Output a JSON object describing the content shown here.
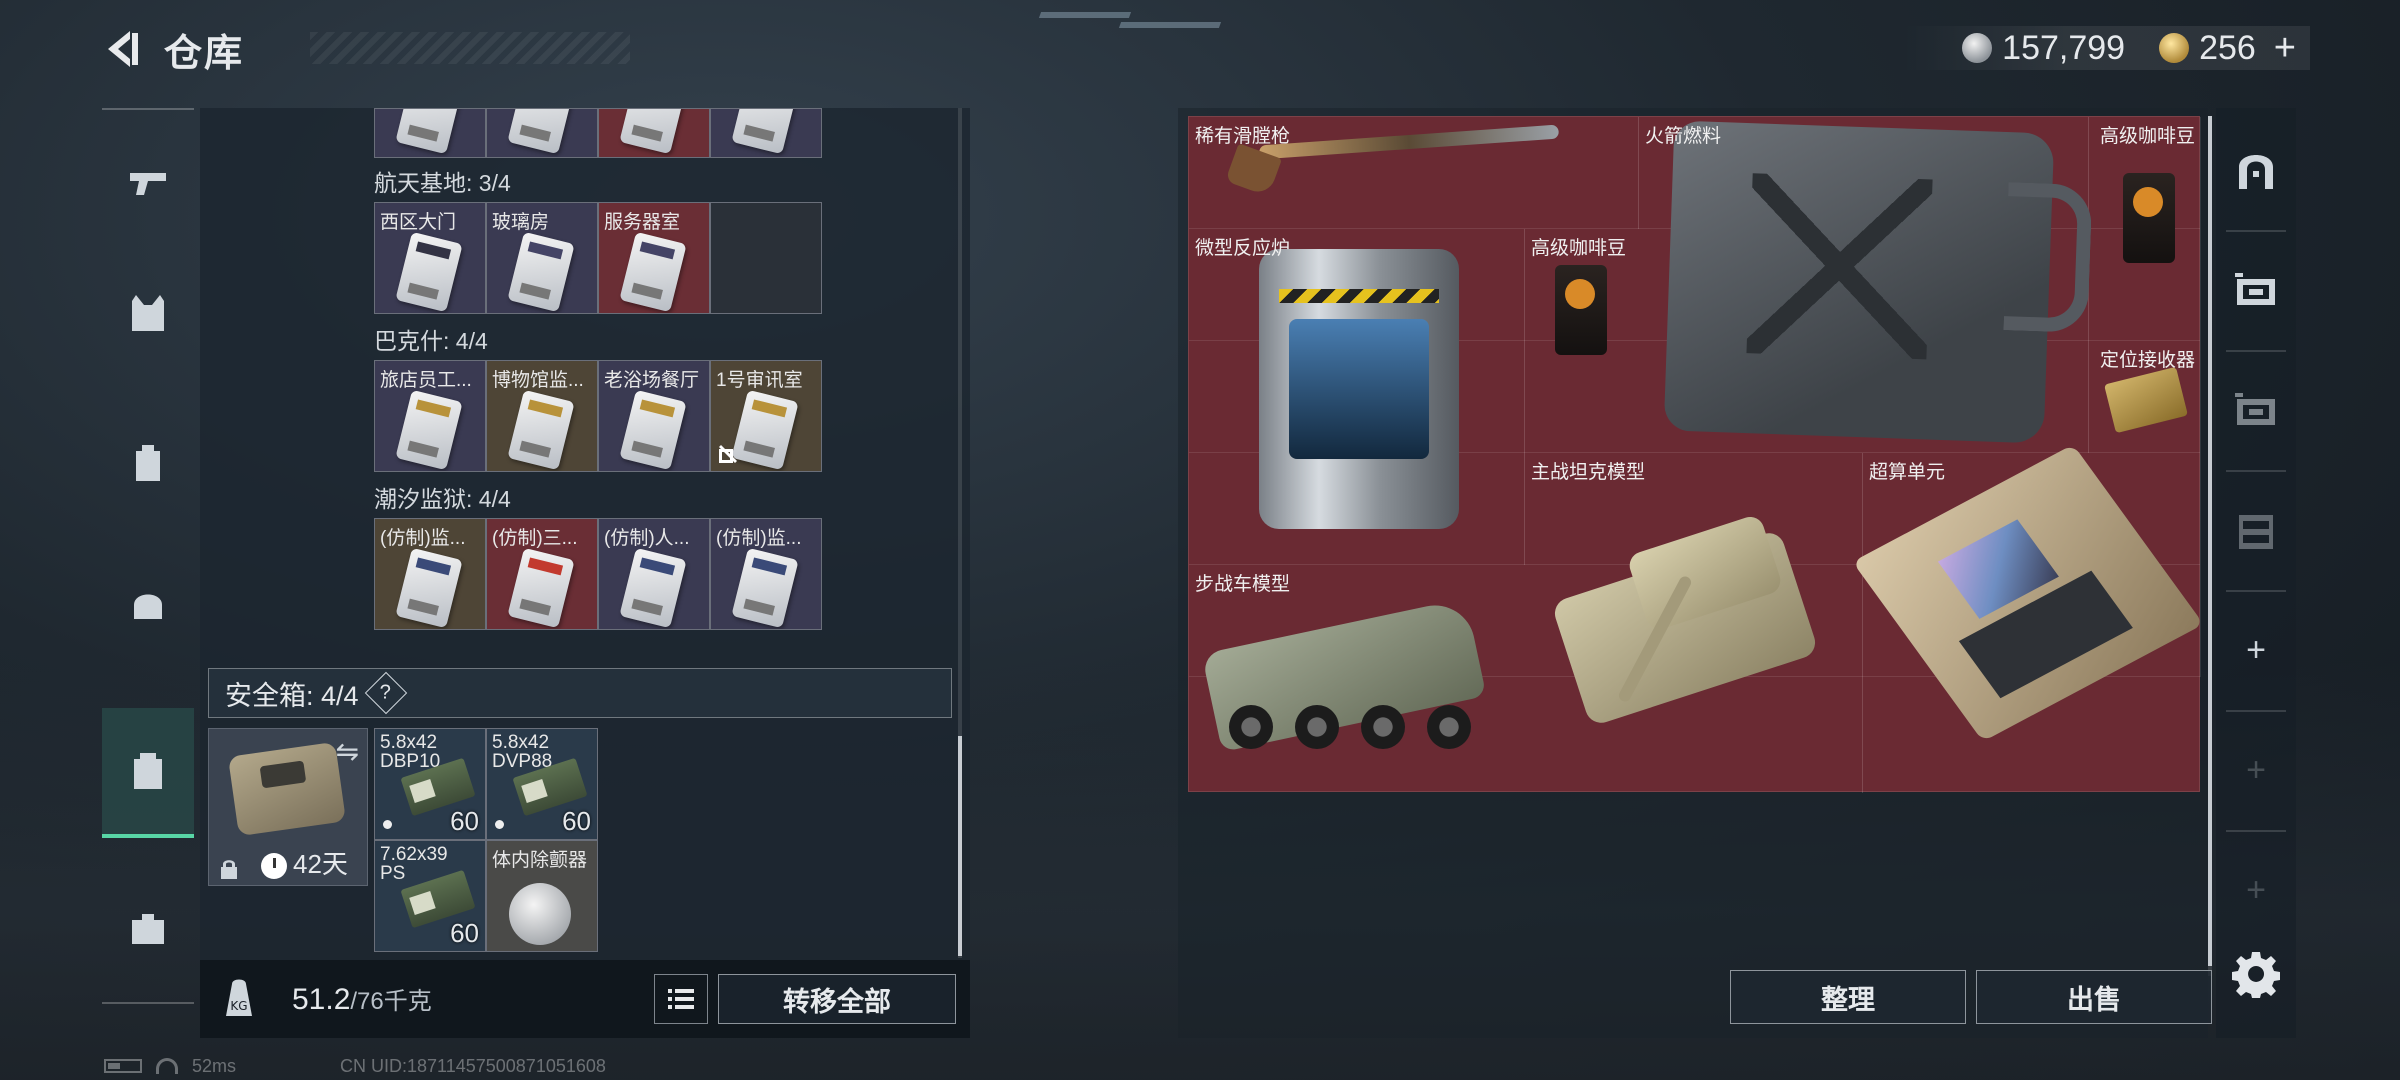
{
  "header": {
    "title": "仓库"
  },
  "currency": {
    "silver": "157,799",
    "gold": "256",
    "plus": "+"
  },
  "left_rail": {
    "items": [
      {
        "name": "weapons",
        "icon": "gun-icon"
      },
      {
        "name": "armor",
        "icon": "vest-icon"
      },
      {
        "name": "backpacks",
        "icon": "backpack-icon"
      },
      {
        "name": "chest-rig",
        "icon": "helmet-bag-icon"
      },
      {
        "name": "safebox",
        "icon": "safebox-icon",
        "active": true
      },
      {
        "name": "case",
        "icon": "toolbox-icon"
      }
    ]
  },
  "keycards": {
    "sections": [
      {
        "title": "航天基地: 3/4",
        "cards": [
          {
            "label": "西区大门",
            "color": "purple"
          },
          {
            "label": "玻璃房",
            "color": "purple"
          },
          {
            "label": "服务器室",
            "color": "red"
          },
          {
            "label": "",
            "color": "empty"
          }
        ]
      },
      {
        "title": "巴克什: 4/4",
        "cards": [
          {
            "label": "旅店员工...",
            "color": "purple"
          },
          {
            "label": "博物馆监...",
            "color": "gold"
          },
          {
            "label": "老浴场餐厅",
            "color": "purple"
          },
          {
            "label": "1号审讯室",
            "color": "gold"
          }
        ]
      },
      {
        "title": "潮汐监狱: 4/4",
        "cards": [
          {
            "label": "(仿制)监...",
            "color": "gold"
          },
          {
            "label": "(仿制)三...",
            "color": "red"
          },
          {
            "label": "(仿制)人...",
            "color": "purple"
          },
          {
            "label": "(仿制)监...",
            "color": "purple"
          }
        ]
      }
    ]
  },
  "safebox": {
    "title": "安全箱: 4/4",
    "help": "?",
    "days": "42天",
    "items": [
      {
        "label": "5.8x42\nDBP10",
        "count": "60"
      },
      {
        "label": "5.8x42\nDVP88",
        "count": "60"
      },
      {
        "label": "7.62x39\nPS",
        "count": "60"
      },
      {
        "label": "体内除颤器",
        "count": ""
      }
    ]
  },
  "footer": {
    "weight": "51.2",
    "max_weight": "/76千克",
    "transfer_label": "转移全部"
  },
  "stash": {
    "items": [
      {
        "label": "稀有滑膛枪"
      },
      {
        "label": "火箭燃料"
      },
      {
        "label": "高级咖啡豆"
      },
      {
        "label": "微型反应炉"
      },
      {
        "label": "高级咖啡豆"
      },
      {
        "label": "定位接收器"
      },
      {
        "label": "主战坦克模型"
      },
      {
        "label": "超算单元"
      },
      {
        "label": "步战车模型"
      }
    ],
    "organize_label": "整理",
    "sell_label": "出售"
  },
  "status": {
    "ping": "52ms",
    "uid": "CN UID:18711457500871051608"
  },
  "colors": {
    "stash_bg": "#6a2a33",
    "active_tab": "#58d6a6",
    "card_purple": "#3a3a52",
    "card_red": "#6a2e35",
    "card_gold": "#4e4536"
  }
}
